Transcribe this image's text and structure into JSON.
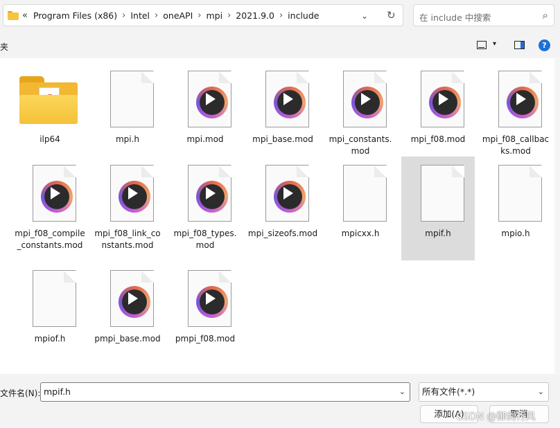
{
  "address": {
    "overflow": "«",
    "crumbs": [
      "Program Files (x86)",
      "Intel",
      "oneAPI",
      "mpi",
      "2021.9.0",
      "include"
    ],
    "separator": "›",
    "dropdown": "⌄",
    "refresh": "↻"
  },
  "search": {
    "placeholder": "在 include 中搜索",
    "icon": "⌕"
  },
  "toolbar": {
    "left_label": "夹",
    "view_drop": "▾",
    "help": "?"
  },
  "files": [
    {
      "name": "ilp64",
      "type": "folder"
    },
    {
      "name": "mpi.h",
      "type": "file"
    },
    {
      "name": "mpi.mod",
      "type": "media"
    },
    {
      "name": "mpi_base.mod",
      "type": "media"
    },
    {
      "name": "mpi_constants.mod",
      "type": "media"
    },
    {
      "name": "mpi_f08.mod",
      "type": "media"
    },
    {
      "name": "mpi_f08_callbacks.mod",
      "type": "media"
    },
    {
      "name": "mpi_f08_compile_constants.mod",
      "type": "media"
    },
    {
      "name": "mpi_f08_link_constants.mod",
      "type": "media"
    },
    {
      "name": "mpi_f08_types.mod",
      "type": "media"
    },
    {
      "name": "mpi_sizeofs.mod",
      "type": "media"
    },
    {
      "name": "mpicxx.h",
      "type": "file"
    },
    {
      "name": "mpif.h",
      "type": "file",
      "selected": true
    },
    {
      "name": "mpio.h",
      "type": "file"
    },
    {
      "name": "mpiof.h",
      "type": "file"
    },
    {
      "name": "pmpi_base.mod",
      "type": "media"
    },
    {
      "name": "pmpi_f08.mod",
      "type": "media"
    }
  ],
  "bottom": {
    "filename_label": "文件名(N):",
    "filename_value": "mpif.h",
    "filetype_value": "所有文件(*.*)",
    "dropdown": "⌄",
    "add_button": "添加(A)",
    "cancel_button": "取消"
  },
  "watermark": "CSDN @御剑行风"
}
